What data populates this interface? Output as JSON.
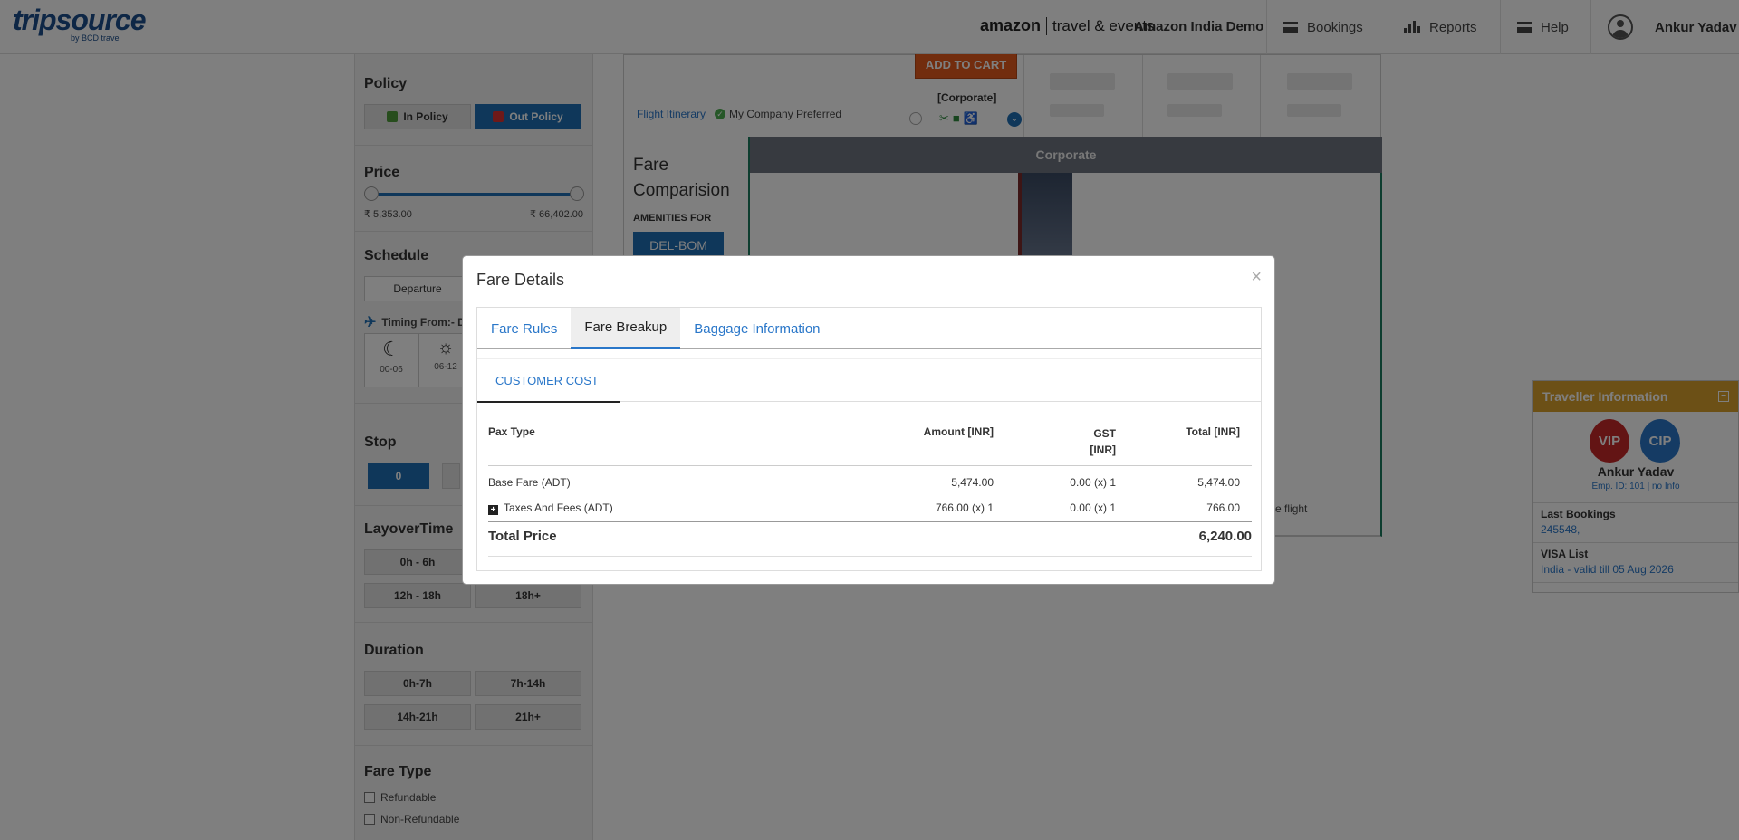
{
  "header": {
    "logo_main": "tripsource",
    "logo_sub": "by BCD travel",
    "amazon_brand": "amazon",
    "amazon_division": "travel & events",
    "company": "Amazon India Demo",
    "nav": {
      "bookings": "Bookings",
      "reports": "Reports",
      "help": "Help"
    },
    "user_name": "Ankur Yadav"
  },
  "sidebar": {
    "policy": {
      "title": "Policy",
      "in": "In Policy",
      "out": "Out Policy"
    },
    "price": {
      "title": "Price",
      "min": "₹ 5,353.00",
      "max": "₹ 66,402.00"
    },
    "schedule": {
      "title": "Schedule",
      "departure_tab": "Departure",
      "timing_label": "Timing From:- D",
      "slot1": "00-06",
      "slot2": "06-12"
    },
    "stop": {
      "title": "Stop",
      "zero": "0"
    },
    "layover": {
      "title": "LayoverTime",
      "opts": [
        "0h - 6h",
        "12h - 18h",
        "18h+"
      ]
    },
    "duration": {
      "title": "Duration",
      "opts": [
        "0h-7h",
        "7h-14h",
        "14h-21h",
        "21h+"
      ]
    },
    "fare_type": {
      "title": "Fare Type",
      "refundable": "Refundable",
      "non_refundable": "Non-Refundable"
    }
  },
  "flight": {
    "add_to_cart": "ADD TO CART",
    "corporate_tag": "[Corporate]",
    "itinerary_link": "Flight Itinerary",
    "preferred": "My Company Preferred",
    "fare_comparison": "Fare Comparision",
    "amenities_for": "AMENITIES FOR",
    "route": "DEL-BOM",
    "corporate_header": "Corporate",
    "trailing_text": "e the flight"
  },
  "traveller": {
    "title": "Traveller Information",
    "vip": "VIP",
    "cip": "CIP",
    "name": "Ankur Yadav",
    "emp": "Emp. ID: 101 | no Info",
    "last_bookings_label": "Last Bookings",
    "last_bookings_value": "245548,",
    "visa_label": "VISA List",
    "visa_value": "India - valid till 05 Aug 2026"
  },
  "modal": {
    "title": "Fare Details",
    "close": "×",
    "tabs": [
      "Fare Rules",
      "Fare Breakup",
      "Baggage Information"
    ],
    "subtab": "CUSTOMER COST",
    "columns": {
      "pax": "Pax Type",
      "amount": "Amount [INR]",
      "gst1": "GST",
      "gst2": "[INR]",
      "total": "Total [INR]"
    },
    "rows": [
      {
        "pax": "Base Fare (ADT)",
        "amount": "5,474.00",
        "gst": "0.00 (x) 1",
        "total": "5,474.00"
      },
      {
        "pax": "Taxes And Fees (ADT)",
        "amount": "766.00 (x) 1",
        "gst": "0.00 (x) 1",
        "total": "766.00"
      }
    ],
    "total_label": "Total Price",
    "total_value": "6,240.00"
  }
}
